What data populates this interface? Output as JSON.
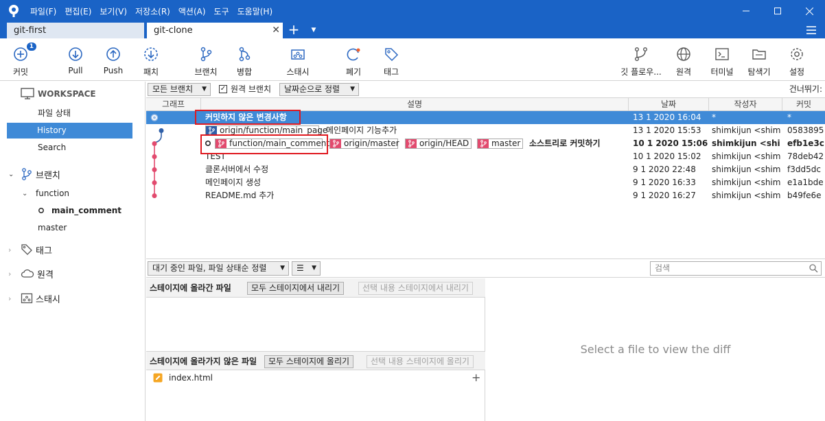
{
  "menu": [
    "파일(F)",
    "편집(E)",
    "보기(V)",
    "저장소(R)",
    "액션(A)",
    "도구",
    "도움말(H)"
  ],
  "tabs": {
    "first": "git-first",
    "clone": "git-clone"
  },
  "toolbar": {
    "commit": "커밋",
    "commit_badge": "1",
    "pull": "Pull",
    "push": "Push",
    "fetch": "패치",
    "branch": "브랜치",
    "merge": "병합",
    "stash": "스태시",
    "discard": "폐기",
    "tag": "태그",
    "git_flow": "깃 플로우...",
    "remote": "원격",
    "terminal": "터미널",
    "explorer": "탐색기",
    "settings": "설정"
  },
  "sidebar": {
    "workspace": "WORKSPACE",
    "file_status": "파일 상태",
    "history": "History",
    "search": "Search",
    "branches": "브랜치",
    "branch_folder": "function",
    "branch_current": "main_comment",
    "branch_master": "master",
    "tags": "태그",
    "remotes": "원격",
    "stashes": "스태시"
  },
  "filter": {
    "all_branches": "모든 브랜치",
    "remote_branches": "원격 브랜치",
    "sort_by_date": "날짜순으로 정렬",
    "skip": "건너뛰기:"
  },
  "columns": {
    "graph": "그래프",
    "description": "설명",
    "date": "날짜",
    "author": "작성자",
    "commit": "커밋"
  },
  "commits": [
    {
      "desc": "커밋하지 않은 변경사항",
      "date": "13 1 2020 16:04",
      "author": "*",
      "hash": "*"
    },
    {
      "desc": "메인페이지 기능추가",
      "date": "13 1 2020 15:53",
      "author": "shimkijun <shimki",
      "hash": "0583895",
      "ref": "origin/function/main_page"
    },
    {
      "desc": "소스트리로 커밋하기",
      "date": "10 1 2020 15:06",
      "author": "shimkijun <shimk",
      "hash": "efb1e3c",
      "refs": [
        "function/main_comment",
        "origin/master",
        "origin/HEAD",
        "master"
      ]
    },
    {
      "desc": "TEST",
      "date": "10 1 2020 15:02",
      "author": "shimkijun <shimki",
      "hash": "78deb42"
    },
    {
      "desc": "클론서버에서 수정",
      "date": "9 1 2020 22:48",
      "author": "shimkijun <shimki",
      "hash": "f3dd5dc"
    },
    {
      "desc": "메인페이지 생성",
      "date": "9 1 2020 16:33",
      "author": "shimkijun <shimki",
      "hash": "e1a1bde"
    },
    {
      "desc": "README.md 추가",
      "date": "9 1 2020 16:27",
      "author": "shimkijun <shimki",
      "hash": "b49fe6e"
    }
  ],
  "bottom": {
    "pending_sort": "대기 중인 파일, 파일 상태순 정렬",
    "search_placeholder": "검색",
    "staged_title": "스테이지에 올라간 파일",
    "unstage_all": "모두 스테이지에서 내리기",
    "unstage_selected": "선택 내용 스테이지에서 내리기",
    "unstaged_title": "스테이지에 올라가지 않은 파일",
    "stage_all": "모두 스테이지에 올리기",
    "stage_selected": "선택 내용 스테이지에 올리기",
    "unstaged_files": [
      "index.html"
    ],
    "diff_placeholder": "Select a file to view the diff"
  },
  "colors": {
    "accent": "#1a63c6",
    "selection": "#3f8ad7",
    "graph_pink": "#e24a6e",
    "graph_blue": "#2f5fa8",
    "highlight_red": "#e0181e"
  }
}
